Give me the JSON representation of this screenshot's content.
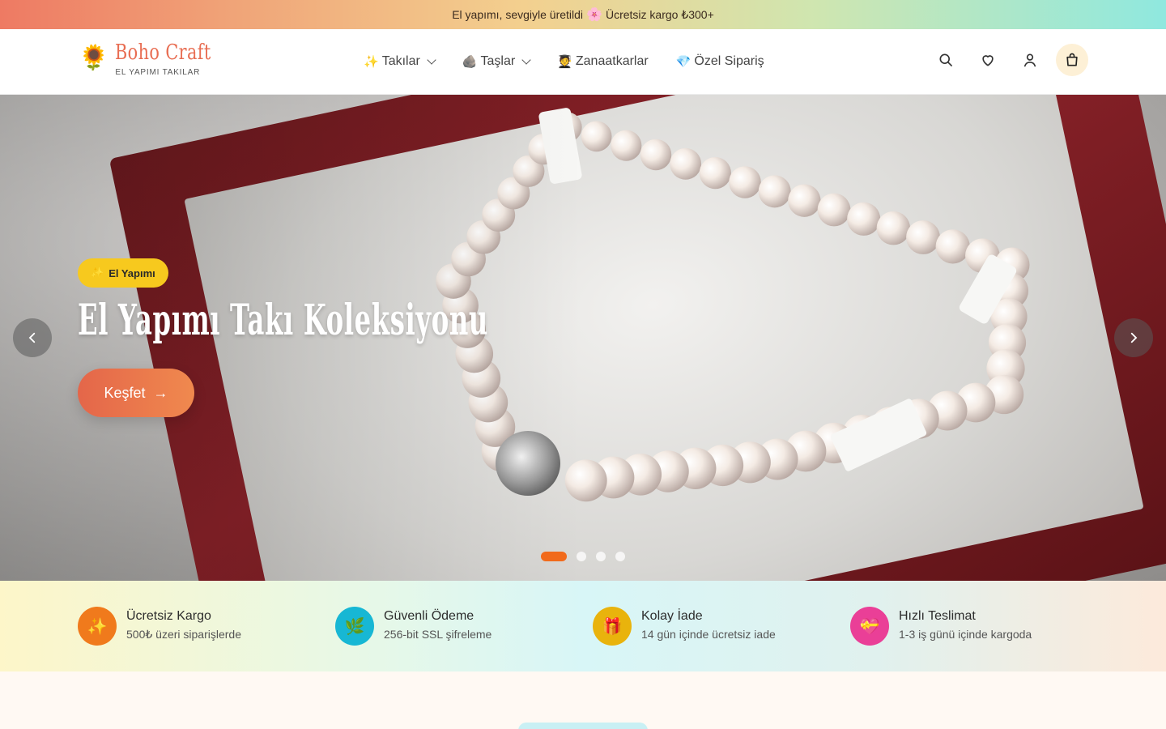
{
  "announcement": {
    "text": "El yapımı, sevgiyle üretildi",
    "flower": "🌸",
    "shipping": "Ücretsiz kargo ₺300+"
  },
  "brand": {
    "logo": "🌻",
    "name": "Boho Craft",
    "tagline": "EL YAPIMI TAKILAR"
  },
  "nav": {
    "items": [
      {
        "emoji": "✨",
        "label": "Takılar",
        "dropdown": true
      },
      {
        "emoji": "🪨",
        "label": "Taşlar",
        "dropdown": true
      },
      {
        "emoji": "🧑‍🎓",
        "label": "Zanaatkarlar",
        "dropdown": false
      },
      {
        "emoji": "💎",
        "label": "Özel Sipariş",
        "dropdown": false
      }
    ]
  },
  "header_icons": [
    "search-icon",
    "heart-icon",
    "user-icon",
    "shopping-bag-icon"
  ],
  "hero": {
    "badge_emoji": "✨",
    "badge": "El Yapımı",
    "title": "El Yapımı Takı Koleksiyonu",
    "cta": "Keşfet",
    "cta_arrow": "→",
    "slides_count": 4,
    "active_slide": 1
  },
  "features": [
    {
      "icon": "✨",
      "title": "Ücretsiz Kargo",
      "subtitle": "500₺ üzeri siparişlerde",
      "color": "#f07a1c"
    },
    {
      "icon": "🌿",
      "title": "Güvenli Ödeme",
      "subtitle": "256-bit SSL şifreleme",
      "color": "#17b7d4"
    },
    {
      "icon": "🎁",
      "title": "Kolay İade",
      "subtitle": "14 gün içinde ücretsiz iade",
      "color": "#e9b30c"
    },
    {
      "icon": "💝",
      "title": "Hızlı Teslimat",
      "subtitle": "1-3 iş günü içinde kargoda",
      "color": "#ea3f97"
    }
  ],
  "colors": {
    "accent": "#e86d52",
    "badge": "#f7c91e",
    "active_dot": "#f16a1b"
  }
}
